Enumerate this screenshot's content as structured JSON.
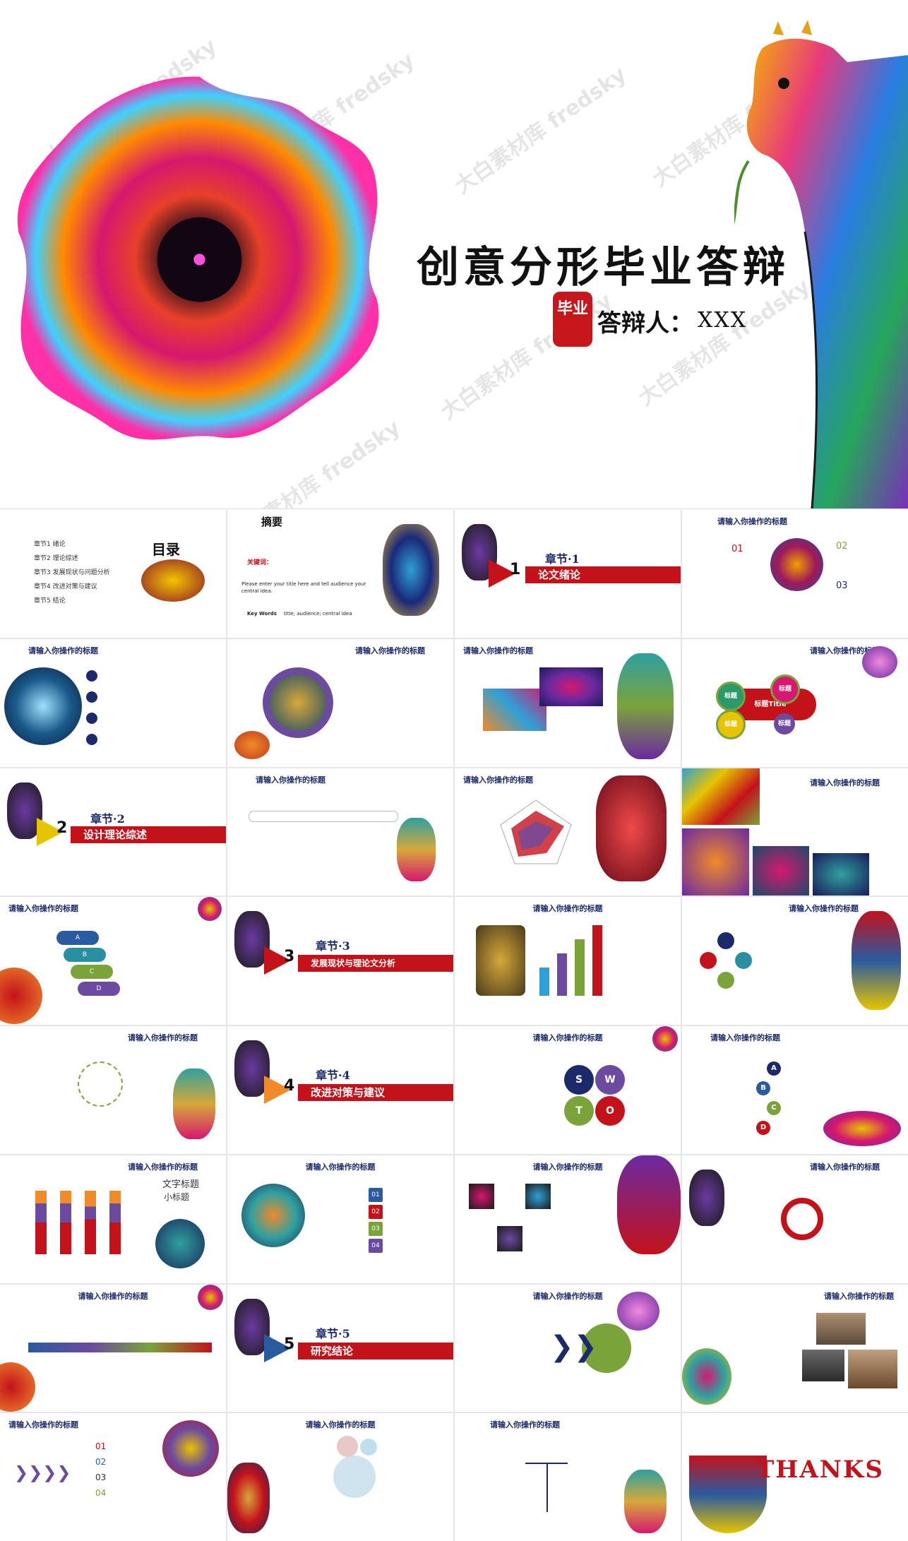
{
  "cover": {
    "title": "创意分形毕业答辩",
    "seal_text": "毕业",
    "presenter_label": "答辩人：",
    "presenter_name": "XXX",
    "watermark": "大白素材库 fredsky"
  },
  "colors": {
    "accent_red": "#c4121b",
    "navy": "#1b2a6b",
    "purple": "#6b4aa0",
    "green": "#7aa33a",
    "teal": "#2f8fa0"
  },
  "slide_header": "请输入你操作的标题",
  "toc": {
    "title": "目录",
    "items": [
      "章节1  绪论",
      "章节2  理论综述",
      "章节3  发展现状与问题分析",
      "章节4  改进对策与建议",
      "章节5  结论"
    ]
  },
  "abstract": {
    "title": "摘要",
    "keyword_label": "关键词：",
    "keyword_label_en": "Key Words",
    "en_text": "Please enter your title here and tell audience your central idea.",
    "en_keywords": "title; audience; central idea"
  },
  "chapters": [
    {
      "num": "1",
      "label": "章节·1",
      "title": "论文绪论"
    },
    {
      "num": "2",
      "label": "章节·2",
      "title": "设计理论综述"
    },
    {
      "num": "3",
      "label": "章节·3",
      "title": "发展现状与理论文分析"
    },
    {
      "num": "4",
      "label": "章节·4",
      "title": "改进对策与建议"
    },
    {
      "num": "5",
      "label": "章节·5",
      "title": "研究结论"
    }
  ],
  "numbered": [
    "01",
    "02",
    "03"
  ],
  "mindmap": {
    "center": "标题Title",
    "nodes": [
      "标题",
      "标题",
      "标题",
      "标题"
    ]
  },
  "swot": [
    "S",
    "W",
    "T",
    "O"
  ],
  "abcd": [
    "A",
    "B",
    "C",
    "D"
  ],
  "steps": [
    "01",
    "02",
    "03",
    "04"
  ],
  "text_title": "文字标题",
  "subtitle": "小标题",
  "end_list": [
    "01",
    "02",
    "03",
    "04"
  ],
  "thanks": "THANKS"
}
